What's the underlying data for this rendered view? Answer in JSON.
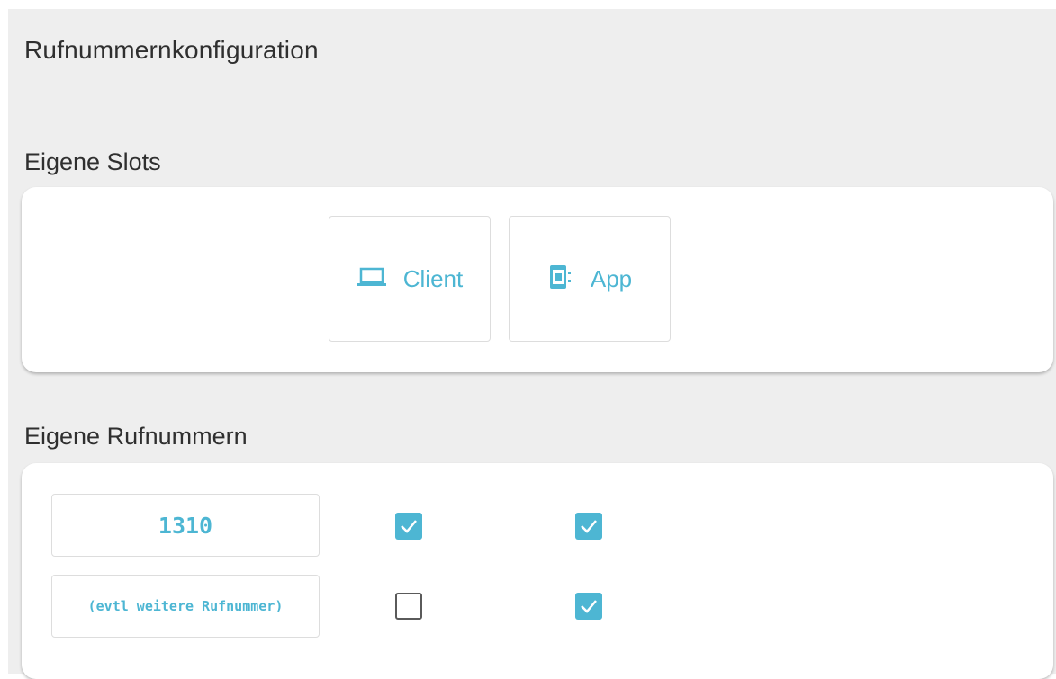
{
  "page": {
    "title": "Rufnummernkonfiguration"
  },
  "slots": {
    "heading": "Eigene Slots",
    "items": [
      {
        "label": "Client",
        "icon": "laptop-icon"
      },
      {
        "label": "App",
        "icon": "mobile-app-icon"
      }
    ]
  },
  "numbers": {
    "heading": "Eigene Rufnummern",
    "rows": [
      {
        "value": "1310",
        "checked_a": true,
        "checked_b": true
      },
      {
        "value": "(evtl weitere Rufnummer)",
        "checked_a": false,
        "checked_b": true
      }
    ]
  },
  "colors": {
    "accent": "#4db6d3",
    "panel_background": "#eeeeee",
    "text": "#2f2f2f"
  }
}
